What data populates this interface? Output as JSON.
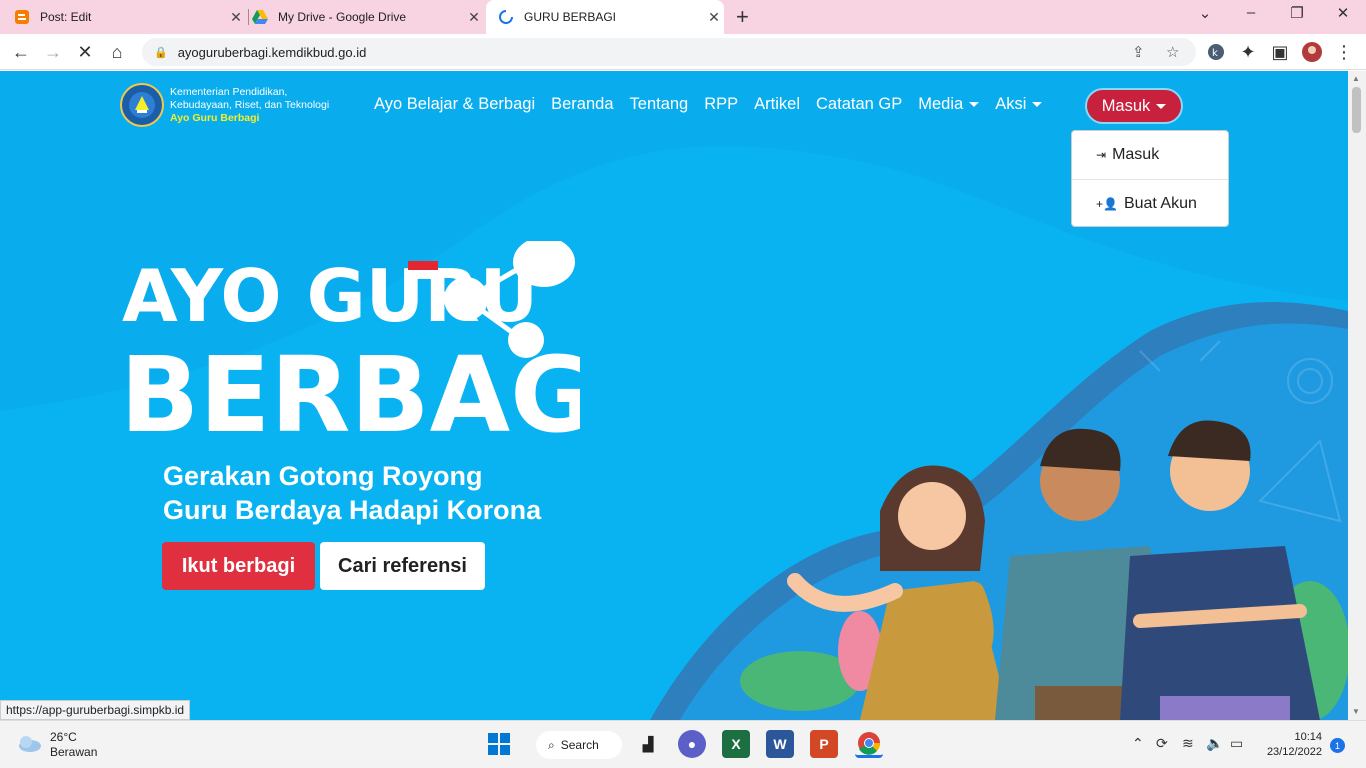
{
  "tabs": [
    {
      "title": "Post: Edit",
      "icon": "blogger-icon"
    },
    {
      "title": "My Drive - Google Drive",
      "icon": "google-drive-icon"
    },
    {
      "title": "GURU BERBAGI",
      "icon": "loading-spinner-icon",
      "active": true
    }
  ],
  "address": {
    "url": "ayoguruberbagi.kemdikbud.go.id"
  },
  "site": {
    "logo_lines": [
      "Kementerian Pendidikan,",
      "Kebudayaan, Riset, dan Teknologi",
      "Ayo Guru Berbagi"
    ],
    "nav": [
      "Ayo Belajar & Berbagi",
      "Beranda",
      "Tentang",
      "RPP",
      "Artikel",
      "Catatan GP",
      "Media",
      "Aksi"
    ],
    "login_button": "Masuk",
    "dropdown": [
      "Masuk",
      "Buat Akun"
    ],
    "hero_title_line1": "AYO GURU",
    "hero_title_line2": "BERBAGI",
    "tagline_line1": "Gerakan Gotong Royong",
    "tagline_line2": "Guru Berdaya Hadapi Korona",
    "cta_primary": "Ikut berbagi",
    "cta_secondary": "Cari referensi"
  },
  "status_url": "https://app-guruberbagi.simpkb.id",
  "taskbar": {
    "weather_temp": "26°C",
    "weather_desc": "Berawan",
    "search_label": "Search",
    "time": "10:14",
    "date": "23/12/2022",
    "notifications": "1"
  },
  "colors": {
    "page_bg": "#09b3f2",
    "login_red": "#c7213d",
    "cta_red": "#e0303f",
    "tab_strip": "#f8d3e2"
  }
}
